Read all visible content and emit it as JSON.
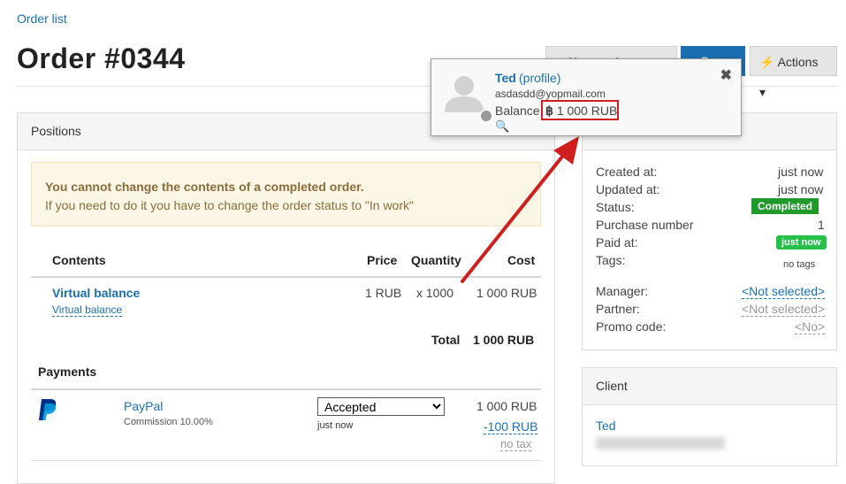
{
  "breadcrumb": "Order list",
  "title": "Order #0344",
  "buttons": {
    "show_order": "Show order page",
    "save": "Save",
    "actions": "Actions"
  },
  "positions_panel": {
    "heading": "Positions",
    "alert_title": "You cannot change the contents of a completed order.",
    "alert_text": "If you need to do it you have to change the order status to \"In work\"",
    "columns": {
      "contents": "Contents",
      "price": "Price",
      "quantity": "Quantity",
      "cost": "Cost"
    },
    "item": {
      "name": "Virtual balance",
      "sub": "Virtual balance",
      "price": "1 RUB",
      "quantity": "x 1000",
      "cost": "1 000 RUB"
    },
    "total_label": "Total",
    "total_value": "1 000 RUB",
    "payments_heading": "Payments",
    "payment": {
      "method": "PayPal",
      "commission": "Commission 10.00%",
      "status": "Accepted",
      "status_options": [
        "Accepted"
      ],
      "time": "just now",
      "amount": "1 000 RUB",
      "fee": "-100 RUB",
      "tax": "no tax"
    }
  },
  "info_panel": {
    "rows": [
      {
        "label": "Created at:",
        "value": "just now"
      },
      {
        "label": "Updated at:",
        "value": "just now"
      },
      {
        "label": "Status:",
        "value": "Completed"
      },
      {
        "label": "Purchase number",
        "value": "1"
      },
      {
        "label": "Paid at:",
        "value": "just now"
      },
      {
        "label": "Tags:",
        "value": "no tags"
      }
    ],
    "links": [
      {
        "label": "Manager:",
        "value": "<Not selected>"
      },
      {
        "label": "Partner:",
        "value": "<Not selected>"
      },
      {
        "label": "Promo code:",
        "value": "<No>"
      }
    ]
  },
  "client_panel": {
    "heading": "Client",
    "name": "Ted"
  },
  "popover": {
    "name": "Ted",
    "profile_link": "(profile)",
    "email": "asdasdd@yopmail.com",
    "balance_label": "Balance:",
    "balance_value": "1 000 RUB"
  },
  "colors": {
    "link": "#1a6fb0",
    "status_completed": "#1f9a2b",
    "paid_badge": "#24c04a",
    "annotation": "#d01f1f"
  }
}
